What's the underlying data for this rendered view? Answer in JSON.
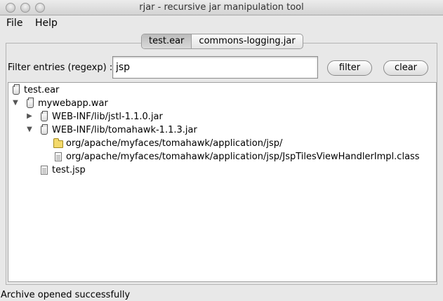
{
  "window": {
    "title": "rjar - recursive jar manipulation tool"
  },
  "menu": {
    "file": "File",
    "help": "Help"
  },
  "tabs": [
    {
      "label": "test.ear",
      "active": true
    },
    {
      "label": "commons-logging.jar",
      "active": false
    }
  ],
  "filter": {
    "label": "Filter entries (regexp) :",
    "value": "jsp",
    "filter_button": "filter",
    "clear_button": "clear"
  },
  "tree": {
    "root": {
      "label": "test.ear",
      "icon": "jar-icon"
    },
    "war": {
      "label": "mywebapp.war",
      "icon": "jar-icon",
      "expanded": true
    },
    "jstl": {
      "label": "WEB-INF/lib/jstl-1.1.0.jar",
      "icon": "jar-icon",
      "expanded": false
    },
    "tomahawk": {
      "label": "WEB-INF/lib/tomahawk-1.1.3.jar",
      "icon": "jar-icon",
      "expanded": true
    },
    "jsp_folder": {
      "label": "org/apache/myfaces/tomahawk/application/jsp/",
      "icon": "folder-icon"
    },
    "jsp_class": {
      "label": "org/apache/myfaces/tomahawk/application/jsp/JspTilesViewHandlerImpl.class",
      "icon": "file-icon"
    },
    "test_jsp": {
      "label": "test.jsp",
      "icon": "file-icon"
    }
  },
  "status": "Archive opened successfully"
}
